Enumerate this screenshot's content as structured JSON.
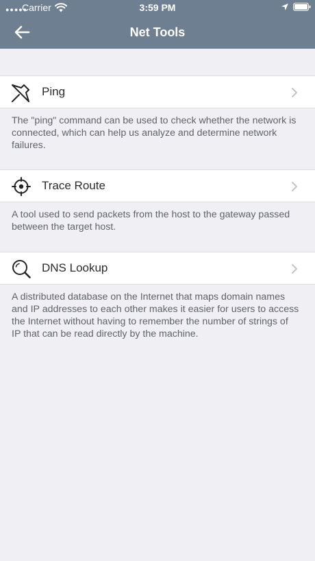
{
  "status_bar": {
    "signal_dots": "●●●●●",
    "carrier": "Carrier",
    "time": "3:59 PM"
  },
  "nav": {
    "title": "Net Tools"
  },
  "tools": [
    {
      "label": "Ping",
      "icon": "pin-icon",
      "description": "The \"ping\" command can be used to check whether the network is connected, which can help us analyze and determine network failures."
    },
    {
      "label": "Trace Route",
      "icon": "crosshair-icon",
      "description": "A tool used to send packets from the host to the gateway passed between the target host."
    },
    {
      "label": "DNS Lookup",
      "icon": "search-icon",
      "description": "A distributed database on the Internet that maps domain names and IP addresses to each other makes it easier for users to access the Internet without having to remember the number of strings of IP that can be read directly by the machine."
    }
  ],
  "colors": {
    "nav_background": "#6e7f91",
    "page_background": "#efeff4",
    "row_background": "#ffffff",
    "description_text": "#5f6368"
  }
}
